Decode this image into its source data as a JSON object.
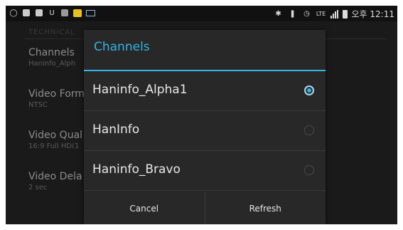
{
  "status_bar": {
    "left_icons": [
      "app-icon",
      "gallery-icon",
      "gallery-icon",
      "usb-debug-icon",
      "image-icon",
      "chat-icon",
      "mail-icon"
    ],
    "usb_text": "U",
    "lte_text": "LTE",
    "time": "오후 12:11"
  },
  "settings_bg": {
    "header": "TECHNICAL",
    "items": [
      {
        "title": "Channels",
        "subtitle": "Haninfo_Alph"
      },
      {
        "title": "Video Form",
        "subtitle": "NTSC"
      },
      {
        "title": "Video Qual",
        "subtitle": "16:9 Full HD(1"
      },
      {
        "title": "Video Dela",
        "subtitle": "2 sec"
      }
    ]
  },
  "dialog": {
    "title": "Channels",
    "options": [
      {
        "label": "Haninfo_Alpha1",
        "selected": true
      },
      {
        "label": "HanInfo",
        "selected": false
      },
      {
        "label": "Haninfo_Bravo",
        "selected": false
      }
    ],
    "cancel_label": "Cancel",
    "refresh_label": "Refresh"
  },
  "colors": {
    "accent": "#33b5e5",
    "dialog_bg": "#282828"
  }
}
